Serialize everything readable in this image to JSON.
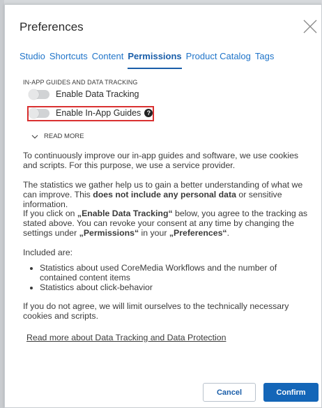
{
  "dialog": {
    "title": "Preferences",
    "tabs": [
      {
        "label": "Studio",
        "active": false
      },
      {
        "label": "Shortcuts",
        "active": false
      },
      {
        "label": "Content",
        "active": false
      },
      {
        "label": "Permissions",
        "active": true
      },
      {
        "label": "Product Catalog",
        "active": false
      },
      {
        "label": "Tags",
        "active": false
      }
    ],
    "section_label": "IN-APP GUIDES AND DATA TRACKING",
    "toggles": [
      {
        "label": "Enable Data Tracking",
        "on": false
      },
      {
        "label": "Enable In-App Guides",
        "on": false
      }
    ],
    "help_glyph": "?",
    "read_more": "READ MORE",
    "paragraphs": {
      "p1": "To continuously improve our in-app guides and software, we use cookies and scripts. For this purpose, we use a service provider.",
      "p2_a": "The statistics we gather help us to gain a better understanding of what we can improve. This ",
      "p2_b": "does not include any personal data",
      "p2_c": " or sensitive information.",
      "p3_a": "If you click on ",
      "p3_b": "„Enable Data Tracking“",
      "p3_c": " below, you agree to the tracking as stated above. You can revoke your consent at any time by changing the settings under ",
      "p3_d": "„Permissions“",
      "p3_e": " in your ",
      "p3_f": "„Preferences“",
      "p3_g": ".",
      "included": "Included are:",
      "bullet1": "Statistics about used CoreMedia Workflows and the number of contained content items",
      "bullet2": "Statistics about click-behavior",
      "p4": "If you do not agree, we will limit ourselves to the technically necessary cookies and scripts."
    },
    "link": "Read more about Data Tracking and Data Protection",
    "buttons": {
      "cancel": "Cancel",
      "confirm": "Confirm"
    },
    "colors": {
      "accent": "#1466b8",
      "link_blue": "#1f74c9",
      "highlight": "#d93030"
    }
  }
}
